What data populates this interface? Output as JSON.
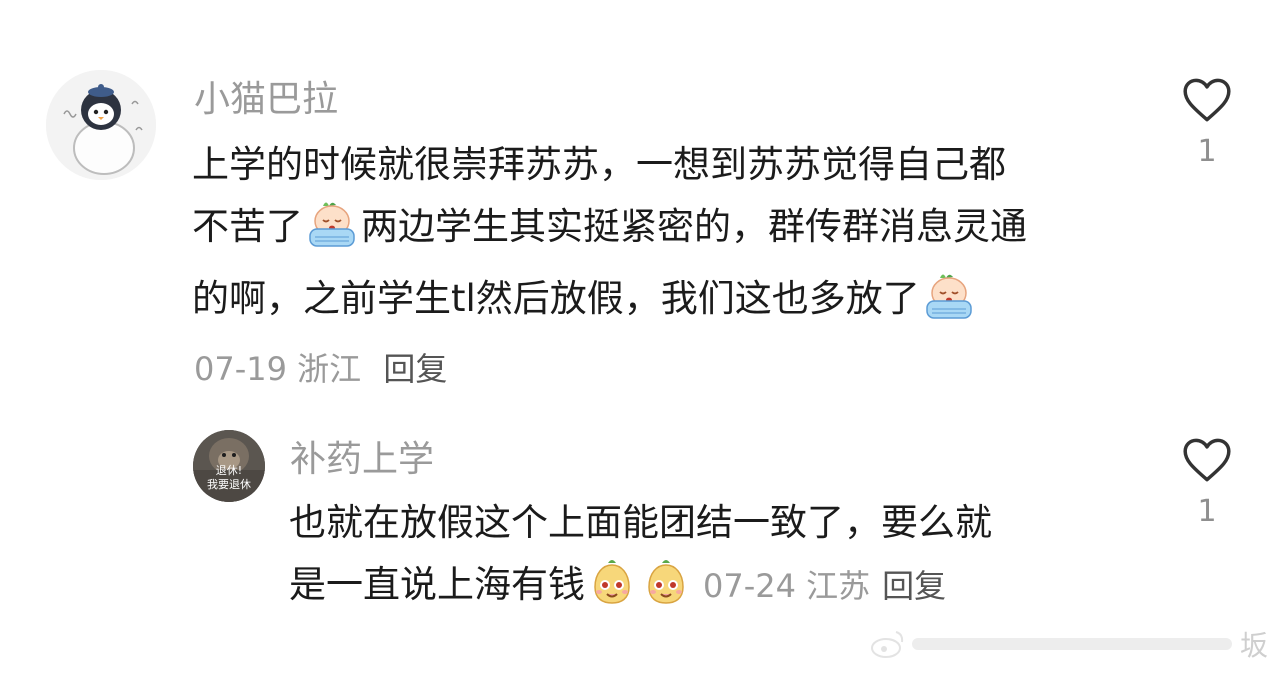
{
  "comments": [
    {
      "username": "小猫巴拉",
      "text_lines": [
        "上学的时候就很崇拜苏苏，一想到苏苏觉得自己都",
        "不苦了",
        "两边学生其实挺紧密的，群传群消息灵通",
        "的啊，之前学生tl然后放假，我们这也多放了"
      ],
      "emoji_name": "crying-face-emoji",
      "date": "07-19",
      "location": "浙江",
      "reply_label": "回复",
      "like_count": "1"
    },
    {
      "username": "补药上学",
      "avatar_text_line1": "退休!",
      "avatar_text_line2": "我要退休",
      "text_lines": [
        "也就在放假这个上面能团结一致了，要么就",
        "是一直说上海有钱"
      ],
      "emoji_name": "smiling-bun-emoji",
      "date": "07-24",
      "location": "江苏",
      "reply_label": "回复",
      "like_count": "1"
    }
  ],
  "watermark_char": "坂"
}
